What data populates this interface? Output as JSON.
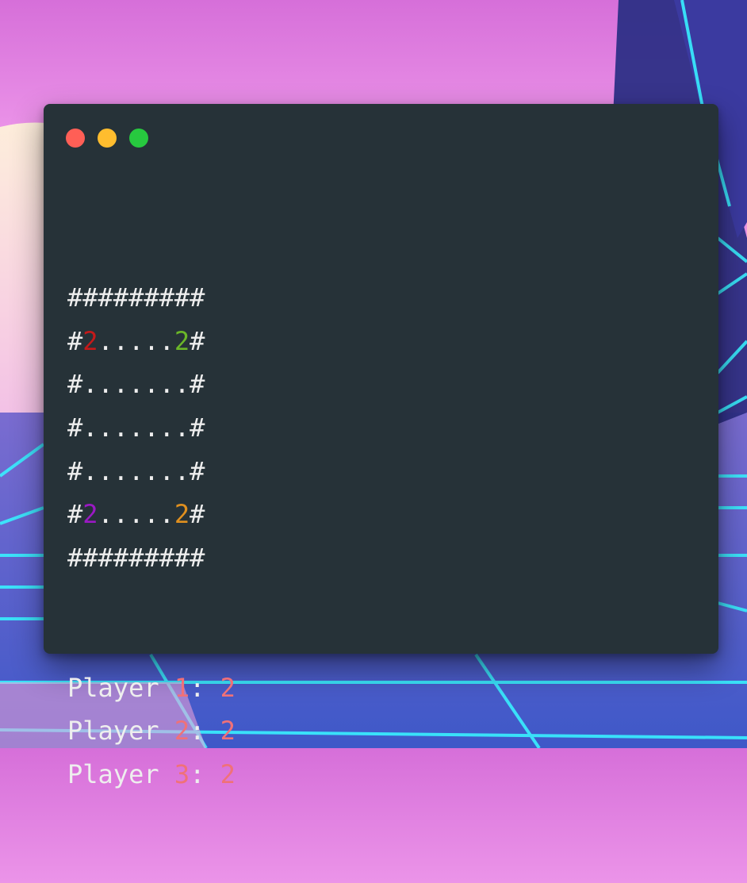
{
  "window": {
    "controls": [
      "close",
      "minimize",
      "maximize"
    ]
  },
  "board": {
    "rows": [
      [
        {
          "t": "#"
        },
        {
          "t": "#"
        },
        {
          "t": "#"
        },
        {
          "t": "#"
        },
        {
          "t": "#"
        },
        {
          "t": "#"
        },
        {
          "t": "#"
        },
        {
          "t": "#"
        },
        {
          "t": "#"
        }
      ],
      [
        {
          "t": "#"
        },
        {
          "t": "2",
          "color": "#c41a1a"
        },
        {
          "t": "."
        },
        {
          "t": "."
        },
        {
          "t": "."
        },
        {
          "t": "."
        },
        {
          "t": "."
        },
        {
          "t": "2",
          "color": "#6bb728"
        },
        {
          "t": "#"
        }
      ],
      [
        {
          "t": "#"
        },
        {
          "t": "."
        },
        {
          "t": "."
        },
        {
          "t": "."
        },
        {
          "t": "."
        },
        {
          "t": "."
        },
        {
          "t": "."
        },
        {
          "t": "."
        },
        {
          "t": "#"
        }
      ],
      [
        {
          "t": "#"
        },
        {
          "t": "."
        },
        {
          "t": "."
        },
        {
          "t": "."
        },
        {
          "t": "."
        },
        {
          "t": "."
        },
        {
          "t": "."
        },
        {
          "t": "."
        },
        {
          "t": "#"
        }
      ],
      [
        {
          "t": "#"
        },
        {
          "t": "."
        },
        {
          "t": "."
        },
        {
          "t": "."
        },
        {
          "t": "."
        },
        {
          "t": "."
        },
        {
          "t": "."
        },
        {
          "t": "."
        },
        {
          "t": "#"
        }
      ],
      [
        {
          "t": "#"
        },
        {
          "t": "2",
          "color": "#9b19c4"
        },
        {
          "t": "."
        },
        {
          "t": "."
        },
        {
          "t": "."
        },
        {
          "t": "."
        },
        {
          "t": "."
        },
        {
          "t": "2",
          "color": "#e0901f"
        },
        {
          "t": "#"
        }
      ],
      [
        {
          "t": "#"
        },
        {
          "t": "#"
        },
        {
          "t": "#"
        },
        {
          "t": "#"
        },
        {
          "t": "#"
        },
        {
          "t": "#"
        },
        {
          "t": "#"
        },
        {
          "t": "#"
        },
        {
          "t": "#"
        }
      ]
    ]
  },
  "scores": [
    {
      "label": "Player ",
      "player": "1",
      "sep": ": ",
      "score": "2"
    },
    {
      "label": "Player ",
      "player": "2",
      "sep": ": ",
      "score": "2"
    },
    {
      "label": "Player ",
      "player": "3",
      "sep": ": ",
      "score": "2"
    }
  ],
  "colors": {
    "terminal_bg": "#263238",
    "text": "#eeeeee",
    "number": "#f07178",
    "close": "#ff5f56",
    "minimize": "#ffbd2e",
    "maximize": "#27c93f"
  }
}
